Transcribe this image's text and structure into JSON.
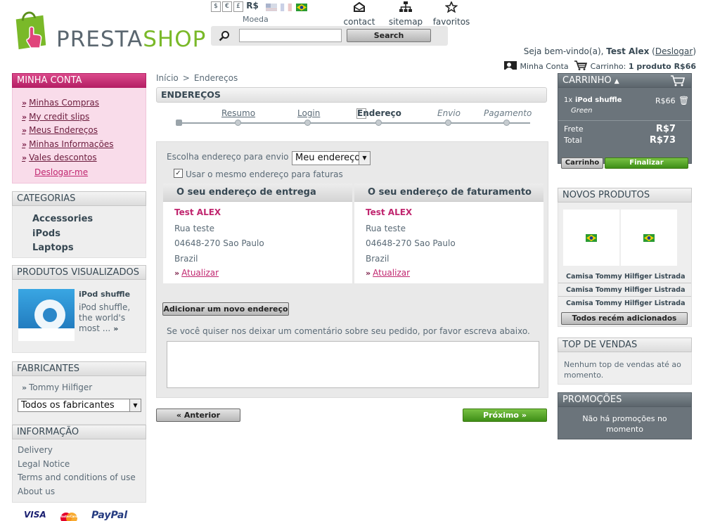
{
  "header": {
    "logo": {
      "part1": "PRESTA",
      "part2": "SHOP"
    },
    "currencies": [
      {
        "symbol": "$"
      },
      {
        "symbol": "€"
      },
      {
        "symbol": "£"
      }
    ],
    "currency_selected": "R$",
    "currency_label": "Moeda",
    "search": {
      "placeholder": "",
      "button": "Search"
    },
    "links": [
      {
        "label": "contact"
      },
      {
        "label": "sitemap"
      },
      {
        "label": "favoritos"
      }
    ],
    "welcome": {
      "prefix": "Seja bem-vindo(a),",
      "name": "Test Alex",
      "logout": "Deslogar"
    },
    "my_account": "Minha Conta",
    "cart_prefix": "Carrinho:",
    "cart_summary": "1 produto R$66"
  },
  "left": {
    "account": {
      "title": "MINHA CONTA",
      "items": [
        "Minhas Compras",
        "My credit slips",
        "Meus Endereços",
        "Minhas Informações",
        "Vales descontos"
      ],
      "logout": "Deslogar-me"
    },
    "categories": {
      "title": "CATEGORIAS",
      "items": [
        "Accessories",
        "iPods",
        "Laptops"
      ]
    },
    "viewed": {
      "title": "PRODUTOS VISUALIZADOS",
      "product": "iPod shuffle",
      "desc": "iPod shuffle, the world's most ..."
    },
    "manufacturers": {
      "title": "FABRICANTES",
      "item": "Tommy Hilfiger",
      "select": "Todos os fabricantes"
    },
    "info": {
      "title": "INFORMAÇÃO",
      "items": [
        "Delivery",
        "Legal Notice",
        "Terms and conditions of use",
        "About us"
      ]
    },
    "payments": [
      "VISA",
      "MasterCard",
      "PayPal"
    ]
  },
  "main": {
    "breadcrumb": {
      "home": "Início",
      "sep": ">",
      "current": "Endereços"
    },
    "title": "ENDEREÇOS",
    "steps": [
      {
        "label": "Resumo"
      },
      {
        "label": "Login"
      },
      {
        "label": "Endereço"
      },
      {
        "label": "Envio"
      },
      {
        "label": "Pagamento"
      }
    ],
    "choose_label": "Escolha endereço para envio",
    "choose_value": "Meu endereço",
    "same_address": "Usar o mesmo endereço para faturas",
    "delivery": {
      "title": "O seu endereço de entrega",
      "name": "Test ALEX",
      "street": "Rua teste",
      "city": "04648-270 Sao Paulo",
      "country": "Brazil",
      "update": "Atualizar"
    },
    "invoice": {
      "title": "O seu endereço de faturamento",
      "name": "Test ALEX",
      "street": "Rua teste",
      "city": "04648-270 Sao Paulo",
      "country": "Brazil",
      "update": "Atualizar"
    },
    "add_address": "Adicionar um novo endereço",
    "comment_label": "Se você quiser nos deixar um comentário sobre seu pedido, por favor escreva abaixo.",
    "prev": "« Anterior",
    "next": "Próximo »"
  },
  "right": {
    "cart": {
      "title": "CARRINHO",
      "qty": "1x",
      "product": "iPod shuffle",
      "variant": "Green",
      "price": "R$66",
      "shipping_label": "Frete",
      "shipping": "R$7",
      "total_label": "Total",
      "total": "R$73",
      "cart_btn": "Carrinho",
      "checkout_btn": "Finalizar"
    },
    "new_products": {
      "title": "NOVOS PRODUTOS",
      "items": [
        "Camisa Tommy Hilfiger Listrada",
        "Camisa Tommy Hilfiger Listrada",
        "Camisa Tommy Hilfiger Listrada"
      ],
      "button": "Todos recém adicionados"
    },
    "top_sales": {
      "title": "TOP DE VENDAS",
      "text": "Nenhum top de vendas até ao momento."
    },
    "promotions": {
      "title": "PROMOÇÕES",
      "text": "Não há promoções no momento"
    }
  },
  "colors": {
    "pink": "#c0266f",
    "green": "#7ab929",
    "cart_gray": "#6b747b"
  }
}
